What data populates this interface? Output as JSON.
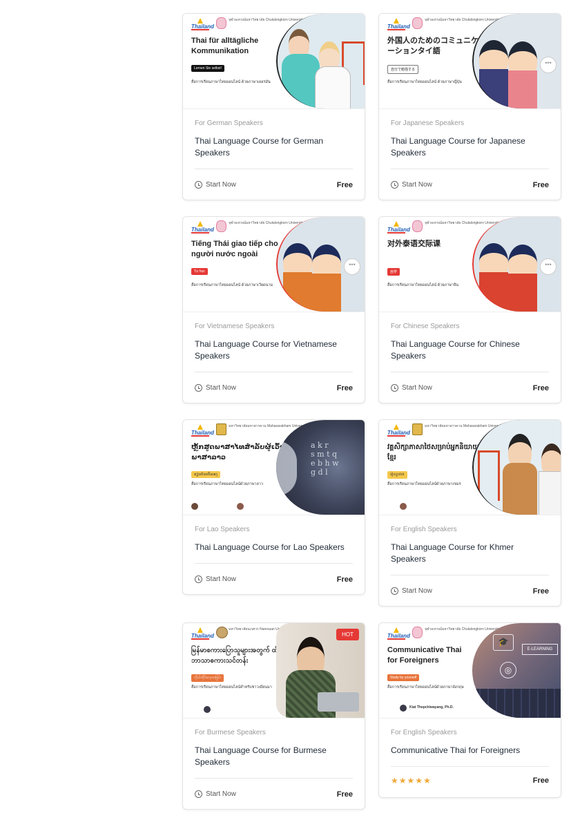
{
  "cards": [
    {
      "thumb_title": "Thai für alltägliche Kommunikation",
      "thumb_badge": "Lernen Sie selbst!",
      "thumb_sub": "สื่อการเรียนภาษาไทยออนไลน์ ด้วยภาษาเยอรมัน",
      "uni": "จุฬาลงกรณ์มหาวิทยาลัย Chulalongkorn University",
      "category": "For German Speakers",
      "title": "Thai Language Course for German Speakers",
      "action": "Start Now",
      "price": "Free"
    },
    {
      "thumb_title": "外国人のためのコミュニケーションタイ語",
      "thumb_badge": "自分で勉強する",
      "thumb_sub": "สื่อการเรียนภาษาไทยออนไลน์ ด้วยภาษาญี่ปุ่น",
      "uni": "จุฬาลงกรณ์มหาวิทยาลัย Chulalongkorn University",
      "category": "For Japanese Speakers",
      "title": "Thai Language Course for Japanese Speakers",
      "action": "Start Now",
      "price": "Free"
    },
    {
      "thumb_title": "Tiếng Thái giao tiếp cho người nước ngoài",
      "thumb_badge": "Tự học",
      "thumb_sub": "สื่อการเรียนภาษาไทยออนไลน์ ด้วยภาษาเวียดนาม",
      "uni": "จุฬาลงกรณ์มหาวิทยาลัย Chulalongkorn University",
      "category": "For Vietnamese Speakers",
      "title": "Thai Language Course for Vietnamese Speakers",
      "action": "Start Now",
      "price": "Free"
    },
    {
      "thumb_title": "对外泰语交际课",
      "thumb_badge": "自学",
      "thumb_sub": "สื่อการเรียนภาษาไทยออนไลน์ ด้วยภาษาจีน",
      "uni": "จุฬาลงกรณ์มหาวิทยาลัย Chulalongkorn University",
      "category": "For Chinese Speakers",
      "title": "Thai Language Course for Chinese Speakers",
      "action": "Start Now",
      "price": "Free"
    },
    {
      "thumb_title": "ຫຼັກສູດພາສາໄທສຳລັບຜູ້ເວົ້າພາສາລາວ",
      "thumb_badge": "ຮຽນດ້ວຍຕົວເອງ",
      "thumb_sub": "สื่อการเรียนภาษาไทยออนไลน์ด้วยภาษาลาว",
      "uni": "มหาวิทยาลัยมหาสารคาม Mahasarakham University",
      "category": "For Lao Speakers",
      "title": "Thai Language Course for Lao Speakers",
      "action": "Start Now",
      "price": "Free"
    },
    {
      "thumb_title": "វគ្គសិក្សាភាសាថៃសម្រាប់អ្នកនិយាយខ្មែរ",
      "thumb_badge": "រៀនខ្លួនឯង",
      "thumb_sub": "สื่อการเรียนภาษาไทยออนไลน์ด้วยภาษาเขมร",
      "uni": "มหาวิทยาลัยมหาสารคาม Mahasarakham University",
      "category": "For English Speakers",
      "title": "Thai Language Course for Khmer Speakers",
      "action": "Start Now",
      "price": "Free"
    },
    {
      "thumb_title": "မြန်မာစကားပြောသူများအတွက် ထိုင်းဘာသာစကားသင်တန်း",
      "thumb_badge": "ကိုယ်တိုင်လေ့လာခြင်း",
      "thumb_sub": "สื่อการเรียนภาษาไทยออนไลน์สำหรับชาวเมียนมา",
      "uni": "มหาวิทยาลัยนเรศวร Naresuan University",
      "hot": "HOT",
      "category": "For Burmese Speakers",
      "title": "Thai Language Course for Burmese Speakers",
      "action": "Start Now",
      "price": "Free"
    },
    {
      "thumb_title": "Communicative Thai for Foreigners",
      "thumb_badge": "Study by yourself",
      "thumb_sub": "สื่อการเรียนภาษาไทยออนไลน์ด้วยภาษาอังกฤษ",
      "uni": "จุฬาลงกรณ์มหาวิทยาลัย Chulalongkorn University",
      "thumb_author": "Kiat Thepchiwayang, Ph.D.",
      "category": "For English Speakers",
      "title": "Communicative Thai for Foreigners",
      "rating": 5,
      "price": "Free"
    }
  ],
  "logo_text": "Thailand",
  "icons": {
    "clock": "clock-icon",
    "star": "star-icon"
  },
  "colors": {
    "accent_red": "#e53935",
    "star": "#f0a93b",
    "badge_yellow": "#f5c84c"
  }
}
